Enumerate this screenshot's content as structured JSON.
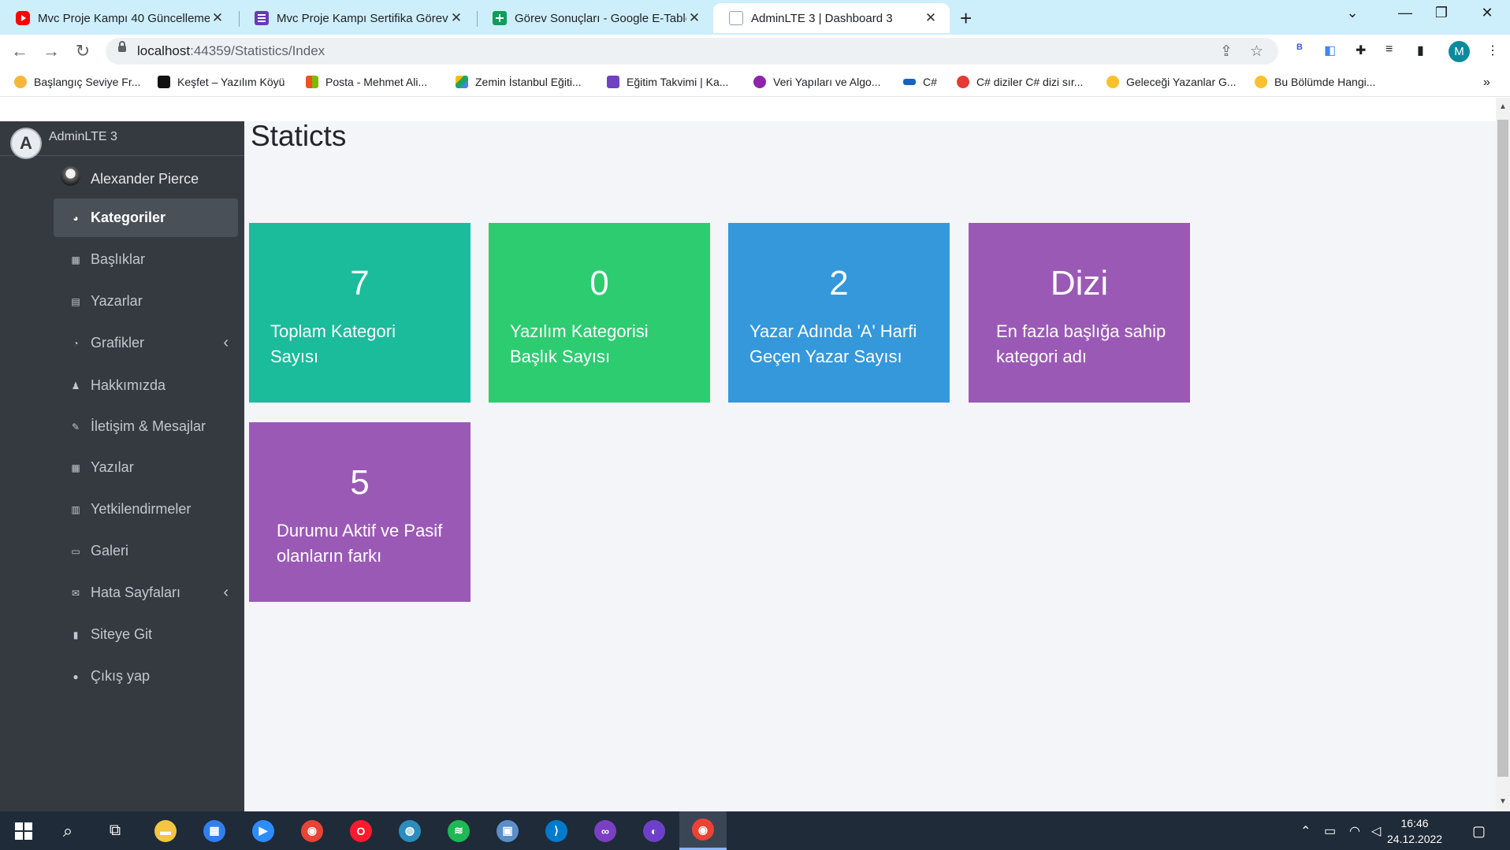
{
  "browser": {
    "tabs": [
      {
        "title": "Mvc Proje Kampı 40 Güncelleme",
        "favicon": "youtube-icon",
        "active": false
      },
      {
        "title": "Mvc Proje Kampı Sertifika Görev",
        "favicon": "forms-icon",
        "active": false
      },
      {
        "title": "Görev Sonuçları - Google E-Tablo",
        "favicon": "sheets-icon",
        "active": false
      },
      {
        "title": "AdminLTE 3 | Dashboard 3",
        "favicon": "document-icon",
        "active": true
      }
    ],
    "url_host": "localhost",
    "url_path": ":44359/Statistics/Index",
    "profile_initial": "M",
    "extension_badge": "B",
    "bookmarks": [
      {
        "label": "Başlangıç Seviye Fr...",
        "color": "#f5b73b"
      },
      {
        "label": "Keşfet – Yazılım Köyü",
        "color": "#111111"
      },
      {
        "label": "Posta - Mehmet Ali...",
        "color": "#f25022"
      },
      {
        "label": "Zemin İstanbul Eğiti...",
        "color": "#1fa463"
      },
      {
        "label": "Eğitim Takvimi | Ka...",
        "color": "#6f42c1"
      },
      {
        "label": "Veri Yapıları ve Algo...",
        "color": "#8e24aa"
      },
      {
        "label": "C#",
        "color": "#1565c0"
      },
      {
        "label": "C# diziler C# dizi sır...",
        "color": "#e53935"
      },
      {
        "label": "Geleceği Yazanlar G...",
        "color": "#fbc02d"
      },
      {
        "label": "Bu Bölümde Hangi...",
        "color": "#fbc02d"
      }
    ]
  },
  "sidebar": {
    "brand": "AdminLTE 3",
    "brand_logo": "A",
    "user_name": "Alexander Pierce",
    "items": [
      {
        "label": "Kategoriler",
        "icon": "dashboard-icon",
        "glyph": "◕",
        "active": true,
        "arrow": false
      },
      {
        "label": "Başlıklar",
        "icon": "grid-icon",
        "glyph": "▦",
        "active": false,
        "arrow": false
      },
      {
        "label": "Yazarlar",
        "icon": "copy-icon",
        "glyph": "▤",
        "active": false,
        "arrow": false
      },
      {
        "label": "Grafikler",
        "icon": "chart-pie-icon",
        "glyph": "◔",
        "active": false,
        "arrow": true
      },
      {
        "label": "Hakkımızda",
        "icon": "bell-icon",
        "glyph": "♟",
        "active": false,
        "arrow": false
      },
      {
        "label": "İletişim & Mesajlar",
        "icon": "edit-icon",
        "glyph": "✎",
        "active": false,
        "arrow": false
      },
      {
        "label": "Yazılar",
        "icon": "table-icon",
        "glyph": "▦",
        "active": false,
        "arrow": false
      },
      {
        "label": "Yetkilendirmeler",
        "icon": "calendar-icon",
        "glyph": "▥",
        "active": false,
        "arrow": false
      },
      {
        "label": "Galeri",
        "icon": "image-icon",
        "glyph": "▭",
        "active": false,
        "arrow": false
      },
      {
        "label": "Hata Sayfaları",
        "icon": "envelope-icon",
        "glyph": "✉",
        "active": false,
        "arrow": true
      },
      {
        "label": "Siteye Git",
        "icon": "file-icon",
        "glyph": "▮",
        "active": false,
        "arrow": false
      },
      {
        "label": "Çıkış yap",
        "icon": "apple-icon",
        "glyph": "●",
        "active": false,
        "arrow": false
      }
    ]
  },
  "main": {
    "title": "Staticts",
    "cards": [
      {
        "value": "7",
        "label": "Toplam Kategori Sayısı",
        "color": "#1abc9c"
      },
      {
        "value": "0",
        "label": "Yazılım Kategorisi Başlık Sayısı",
        "color": "#2ecc71"
      },
      {
        "value": "2",
        "label": "Yazar Adında 'A' Harfi Geçen Yazar Sayısı",
        "color": "#3498db"
      },
      {
        "value": "Dizi",
        "label": "En fazla başlığa sahip kategori adı",
        "color": "#9b59b6"
      },
      {
        "value": "5",
        "label": "Durumu Aktif ve Pasif olanların farkı",
        "color": "#9b59b6"
      }
    ]
  },
  "taskbar": {
    "apps": [
      {
        "name": "file-explorer-icon",
        "color": "#f4c542",
        "glyph": "▬"
      },
      {
        "name": "store-icon",
        "color": "#2f80ed",
        "glyph": "▦"
      },
      {
        "name": "zoom-icon",
        "color": "#2d8cff",
        "glyph": "▶"
      },
      {
        "name": "chrome-icon",
        "color": "#ea4335",
        "glyph": "◉"
      },
      {
        "name": "opera-icon",
        "color": "#ff1b2d",
        "glyph": "O"
      },
      {
        "name": "search-app-icon",
        "color": "#2b8cbe",
        "glyph": "◍"
      },
      {
        "name": "spotify-icon",
        "color": "#1db954",
        "glyph": "≋"
      },
      {
        "name": "remote-desktop-icon",
        "color": "#5b8fc7",
        "glyph": "▣"
      },
      {
        "name": "vscode-icon",
        "color": "#007acc",
        "glyph": "⟩"
      },
      {
        "name": "visual-studio-icon",
        "color": "#7b3fc4",
        "glyph": "∞"
      },
      {
        "name": "github-icon",
        "color": "#6e40c9",
        "glyph": "◐"
      },
      {
        "name": "chrome-profile-icon",
        "color": "#ea4335",
        "glyph": "◉"
      }
    ],
    "time": "16:46",
    "date": "24.12.2022"
  }
}
